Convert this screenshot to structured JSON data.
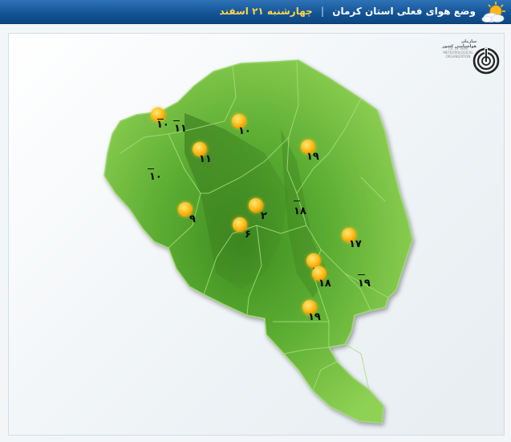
{
  "header": {
    "title": "وضع هوای فعلی استان کرمان",
    "separator": "|",
    "date": "چهارشنبه ۲۱ اسفند",
    "icon": "sun-cloud-icon"
  },
  "logo": {
    "name": "سازمان هواشناسی کشور",
    "sub": "I.R. OF IRAN METEOROLOGICAL ORGANIZATION",
    "icon": "meteorological-org-logo"
  },
  "colors": {
    "title_bar": "#145597",
    "land": "#5fae33",
    "sun": "#ffbf1a"
  },
  "stations": [
    {
      "id": "s1",
      "temp_label": "۱۰",
      "value": -10,
      "condition": "sunny"
    },
    {
      "id": "s2",
      "temp_label": "۱۱",
      "value": -11,
      "condition": "none"
    },
    {
      "id": "s3",
      "temp_label": "۱۰",
      "value": 10,
      "condition": "sunny"
    },
    {
      "id": "s4",
      "temp_label": "۱۹",
      "value": 19,
      "condition": "sunny"
    },
    {
      "id": "s5",
      "temp_label": "۱۱",
      "value": 11,
      "condition": "sunny"
    },
    {
      "id": "s6",
      "temp_label": "۱۰",
      "value": -10,
      "condition": "none"
    },
    {
      "id": "s7",
      "temp_label": "۲",
      "value": 2,
      "condition": "sunny"
    },
    {
      "id": "s8",
      "temp_label": "۱۸",
      "value": -18,
      "condition": "none"
    },
    {
      "id": "s9",
      "temp_label": "۹",
      "value": 9,
      "condition": "sunny"
    },
    {
      "id": "s10",
      "temp_label": "۶",
      "value": 6,
      "condition": "sunny"
    },
    {
      "id": "s11",
      "temp_label": "۱۷",
      "value": 17,
      "condition": "sunny"
    },
    {
      "id": "s12",
      "temp_label": "۱۷",
      "value": 17,
      "condition": "sunny"
    },
    {
      "id": "s13",
      "temp_label": "۱۸",
      "value": 18,
      "condition": "sunny"
    },
    {
      "id": "s14",
      "temp_label": "۱۹",
      "value": -19,
      "condition": "none"
    },
    {
      "id": "s15",
      "temp_label": "۱۹",
      "value": 19,
      "condition": "sunny"
    }
  ]
}
